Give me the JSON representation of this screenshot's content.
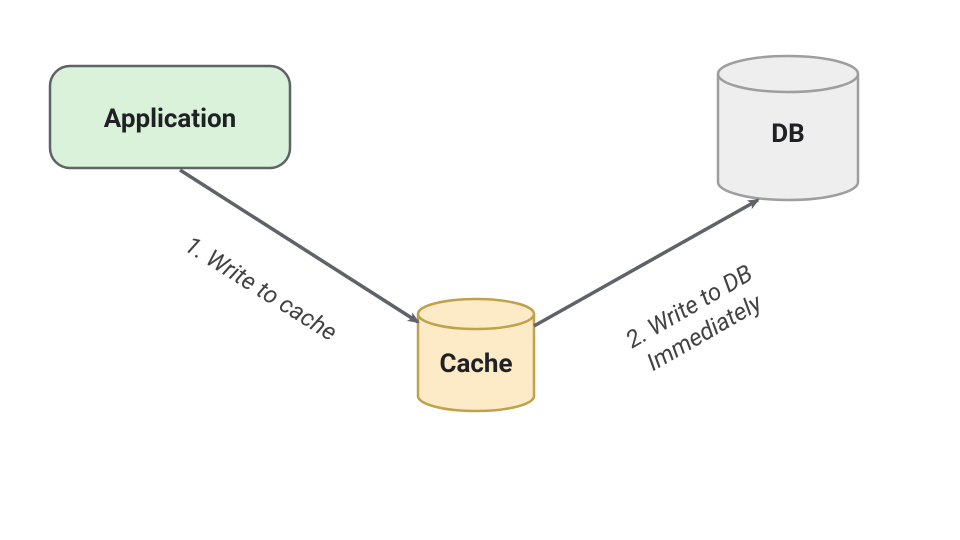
{
  "diagram": {
    "nodes": {
      "application": {
        "label": "Application",
        "fill": "#d9f2d9",
        "stroke": "#5f6368"
      },
      "cache": {
        "label": "Cache",
        "fill": "#fdebc8",
        "stroke": "#bfa24a"
      },
      "db": {
        "label": "DB",
        "fill": "#eeeeee",
        "stroke": "#9e9e9e"
      }
    },
    "edges": {
      "app_to_cache": {
        "label": "1. Write to cache"
      },
      "cache_to_db_1": {
        "label": "2. Write to DB"
      },
      "cache_to_db_2": {
        "label": "Immediately"
      }
    }
  }
}
